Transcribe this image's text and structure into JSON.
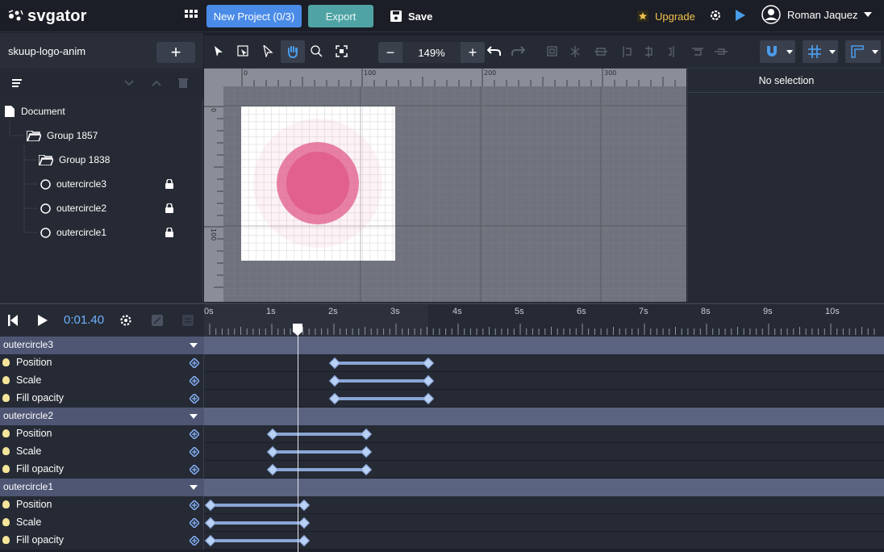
{
  "brand": {
    "name": "svgator"
  },
  "topbar": {
    "new_project": "New Project (0/3)",
    "export": "Export",
    "save": "Save",
    "upgrade": "Upgrade",
    "user": "Roman Jaquez"
  },
  "project": {
    "name": "skuup-logo-anim"
  },
  "layers": {
    "document": "Document",
    "group1": "Group 1857",
    "group2": "Group 1838",
    "items": [
      "outercircle3",
      "outercircle2",
      "outercircle1"
    ]
  },
  "zoom": {
    "value": "149%"
  },
  "ruler": {
    "h": [
      "0",
      "100",
      "200",
      "300"
    ],
    "v": [
      "0",
      "100"
    ]
  },
  "rightpanel": {
    "title": "No selection"
  },
  "timeline": {
    "time": "0:01.40",
    "ticks": [
      "0s",
      "1s",
      "2s",
      "3s",
      "4s",
      "5s",
      "6s",
      "7s",
      "8s",
      "9s",
      "10s"
    ],
    "groups": [
      {
        "name": "outercircle3",
        "props": [
          "Position",
          "Scale",
          "Fill opacity"
        ]
      },
      {
        "name": "outercircle2",
        "props": [
          "Position",
          "Scale",
          "Fill opacity"
        ]
      },
      {
        "name": "outercircle1",
        "props": [
          "Position",
          "Scale",
          "Fill opacity"
        ]
      }
    ]
  },
  "colors": {
    "accent": "#4a8be8",
    "teal": "#4fa3a5",
    "circle": "#e05a8a",
    "upgrade": "#f2c14b"
  }
}
